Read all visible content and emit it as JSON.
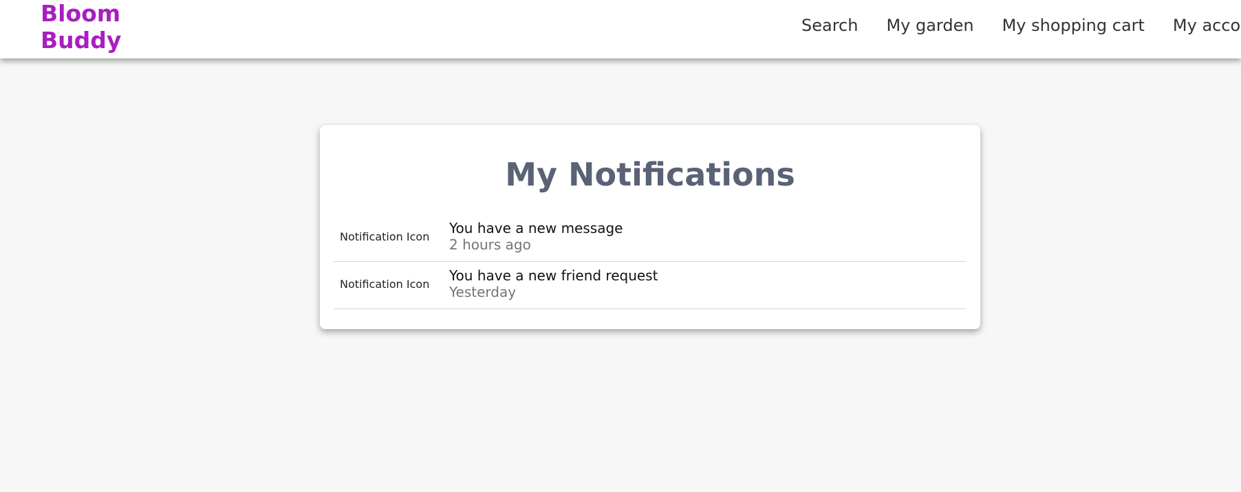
{
  "header": {
    "logo_line1": "Bloom",
    "logo_line2": "Buddy",
    "nav": [
      {
        "label": "Search"
      },
      {
        "label": "My garden"
      },
      {
        "label": "My shopping cart"
      },
      {
        "label": "My account"
      }
    ]
  },
  "main": {
    "title": "My Notifications",
    "notifications": [
      {
        "icon_alt": "Notification Icon",
        "message": "You have a new message",
        "time": "2 hours ago"
      },
      {
        "icon_alt": "Notification Icon",
        "message": "You have a new friend request",
        "time": "Yesterday"
      }
    ]
  },
  "colors": {
    "brand": "#a81fbf",
    "title": "#5a6275",
    "page_background": "#f7f7f7",
    "muted_text": "#757575"
  }
}
